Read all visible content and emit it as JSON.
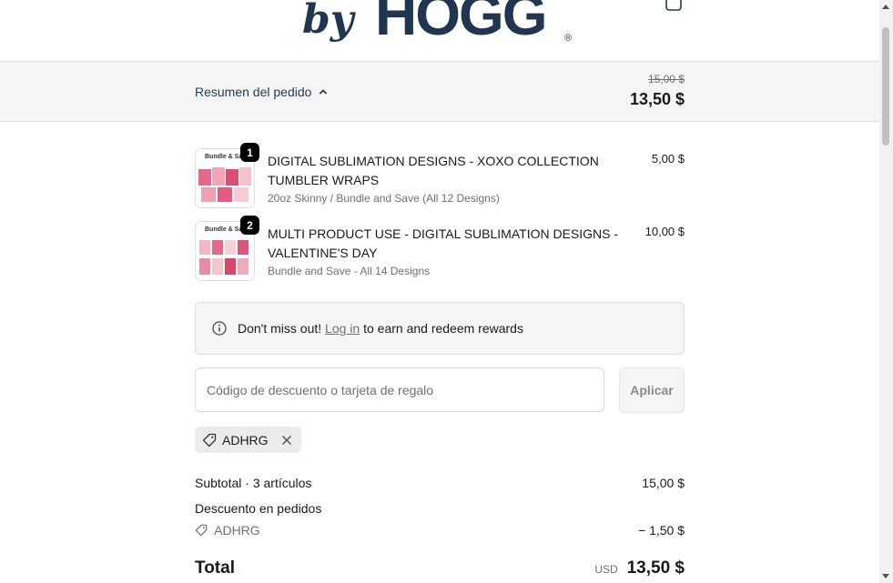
{
  "header": {
    "logo_text": "HOGG",
    "logo_prefix": "by",
    "cart_icon": "shopping-bag-icon"
  },
  "summary": {
    "toggle_label": "Resumen del pedido",
    "old_price": "15,00 $",
    "new_price": "13,50 $",
    "colors": {
      "link": "#1d3b55",
      "panel": "#f5f5f5"
    }
  },
  "products": [
    {
      "quantity": "1",
      "name": "DIGITAL SUBLIMATION DESIGNS - XOXO COLLECTION TUMBLER WRAPS",
      "variant": "20oz Skinny / Bundle and Save (All 12 Designs)",
      "price": "5,00 $",
      "thumb_caption": "Bundle & Save"
    },
    {
      "quantity": "2",
      "name": "MULTI PRODUCT USE - DIGITAL SUBLIMATION DESIGNS - VALENTINE'S DAY",
      "variant": "Bundle and Save - All 14 Designs",
      "price": "10,00 $",
      "thumb_caption": "Bundle & Save"
    }
  ],
  "rewards": {
    "prefix": "Don't miss out!",
    "link": "Log in",
    "suffix": "to earn and redeem rewards"
  },
  "discount": {
    "placeholder": "Código de descuento o tarjeta de regalo",
    "apply_label": "Aplicar",
    "applied_code": "ADHRG"
  },
  "totals": {
    "subtotal_label": "Subtotal · 3 artículos",
    "subtotal_value": "15,00 $",
    "order_discount_label": "Descuento en pedidos",
    "discount_code": "ADHRG",
    "discount_value": "− 1,50 $",
    "total_label": "Total",
    "currency": "USD",
    "total_value": "13,50 $"
  }
}
